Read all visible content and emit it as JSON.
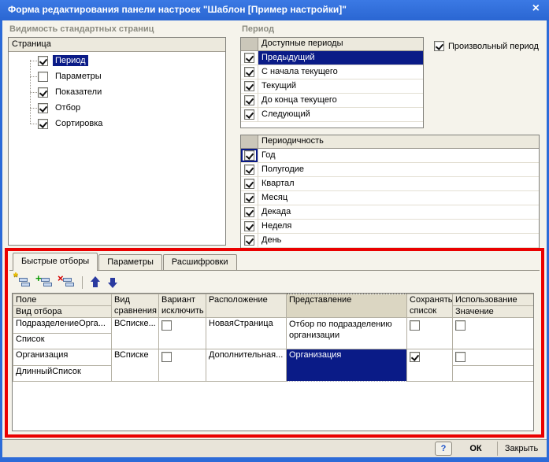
{
  "window": {
    "title": "Форма редактирования панели настроек \"Шаблон [Пример настройки]\"",
    "close_glyph": "×"
  },
  "visibility_group": {
    "label": "Видимость стандартных страниц",
    "column_header": "Страница",
    "items": [
      {
        "label": "Период",
        "checked": true,
        "selected": true
      },
      {
        "label": "Параметры",
        "checked": false,
        "selected": false
      },
      {
        "label": "Показатели",
        "checked": true,
        "selected": false
      },
      {
        "label": "Отбор",
        "checked": true,
        "selected": false
      },
      {
        "label": "Сортировка",
        "checked": true,
        "selected": false
      }
    ]
  },
  "period_group": {
    "label": "Период",
    "available_periods": {
      "header": "Доступные периоды",
      "rows": [
        {
          "label": "Предыдущий",
          "checked": true,
          "selected": true
        },
        {
          "label": "С начала текущего",
          "checked": true,
          "selected": false
        },
        {
          "label": "Текущий",
          "checked": true,
          "selected": false
        },
        {
          "label": "До конца текущего",
          "checked": true,
          "selected": false
        },
        {
          "label": "Следующий",
          "checked": true,
          "selected": false
        }
      ]
    },
    "arbitrary_period": {
      "label": "Произвольный период",
      "checked": true
    },
    "periodicity": {
      "header": "Периодичность",
      "rows": [
        {
          "label": "Год",
          "checked": true,
          "focused": true
        },
        {
          "label": "Полугодие",
          "checked": true,
          "focused": false
        },
        {
          "label": "Квартал",
          "checked": true,
          "focused": false
        },
        {
          "label": "Месяц",
          "checked": true,
          "focused": false
        },
        {
          "label": "Декада",
          "checked": true,
          "focused": false
        },
        {
          "label": "Неделя",
          "checked": true,
          "focused": false
        },
        {
          "label": "День",
          "checked": true,
          "focused": false
        }
      ]
    }
  },
  "filters_panel": {
    "tabs": [
      {
        "label": "Быстрые отборы",
        "active": true
      },
      {
        "label": "Параметры",
        "active": false
      },
      {
        "label": "Расшифровки",
        "active": false
      }
    ],
    "toolbar": {
      "add_badge": "*",
      "insert_badge": "+",
      "delete_badge": "×"
    },
    "table": {
      "headers": {
        "field_line1": "Поле",
        "field_line2": "Вид отбора",
        "comparison": "Вид сравнения",
        "variant": "Вариант исключить",
        "location": "Расположение",
        "presentation": "Представление",
        "save_list": "Сохранять список",
        "usage_line1": "Использование",
        "usage_line2": "Значение"
      },
      "rows": [
        {
          "field": "ПодразделениеОрга...",
          "filter_kind": "Список",
          "comparison": "ВСписке...",
          "exclude": false,
          "location": "НоваяСтраница",
          "presentation": "Отбор по подразделению организации",
          "save_list": false,
          "use": false
        },
        {
          "field": "Организация",
          "filter_kind": "ДлинныйСписок",
          "comparison": "ВСписке",
          "exclude": false,
          "location": "Дополнительная...",
          "presentation": "Организация",
          "save_list": true,
          "use": false
        }
      ]
    }
  },
  "footer": {
    "help": "?",
    "ok": "ОК",
    "close": "Закрыть"
  }
}
